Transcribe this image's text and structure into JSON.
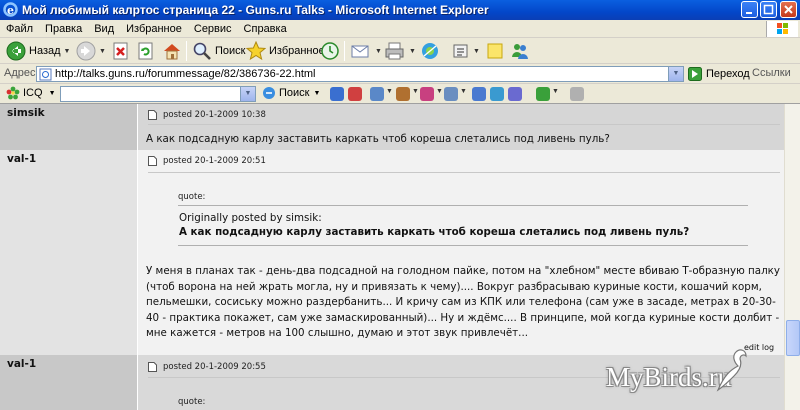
{
  "window": {
    "title": "Мой любимый калртос страница 22 - Guns.ru Talks - Microsoft Internet Explorer"
  },
  "menu": {
    "items": [
      "Файл",
      "Правка",
      "Вид",
      "Избранное",
      "Сервис",
      "Справка"
    ]
  },
  "toolbar": {
    "back_label": "Назад",
    "search_label": "Поиск",
    "favorites_label": "Избранное"
  },
  "address_bar": {
    "label": "Адрес:",
    "url": "http://talks.guns.ru/forummessage/82/386736-22.html",
    "go_label": "Переход",
    "links_label": "Ссылки"
  },
  "icq_bar": {
    "icq_label": "ICQ",
    "search_value": "",
    "find_label": "Поиск"
  },
  "posts": [
    {
      "author": "simsik",
      "posted": "posted 20-1-2009 10:38",
      "body": "А как подсадную карлу заставить каркать чтоб кореша слетались под ливень пуль?"
    },
    {
      "author": "val-1",
      "posted": "posted 20-1-2009 20:51",
      "quote_label": "quote:",
      "quote_by": "Originally posted by simsik:",
      "quote_text": "А как подсадную карлу заставить каркать чтоб кореша слетались под ливень пуль?",
      "body_lines": [
        "У меня в планах так - день-два подсадной на голодном пайке, потом на \"хлебном\" месте вбиваю Т-образную палку",
        "(чтоб ворона на ней жрать могла, ну и привязать к чему).... Вокруг разбрасываю куриные кости, кошачий корм,",
        "пельмешки, сосиську можно раздербанить... И кричу сам из КПК или телефона (сам уже в засаде, метрах в 20-30-",
        "40 - практика покажет, сам уже замаскированный)... Ну и ждёмс.... В принципе, мой когда куриные кости долбит -",
        "мне кажется - метров на 100 слышно, думаю и этот звук привлечёт..."
      ],
      "edit_log": "edit log"
    },
    {
      "author": "val-1",
      "posted": "posted 20-1-2009 20:55",
      "quote_label": "quote:"
    }
  ],
  "watermark": {
    "text": "MyBirds.ru"
  },
  "colors": {
    "title_bar": "#0347c9",
    "toolbar_bg": "#ece9d8",
    "post_bg_dark": "#d6d6d6",
    "post_bg_light": "#f2f2f2"
  }
}
